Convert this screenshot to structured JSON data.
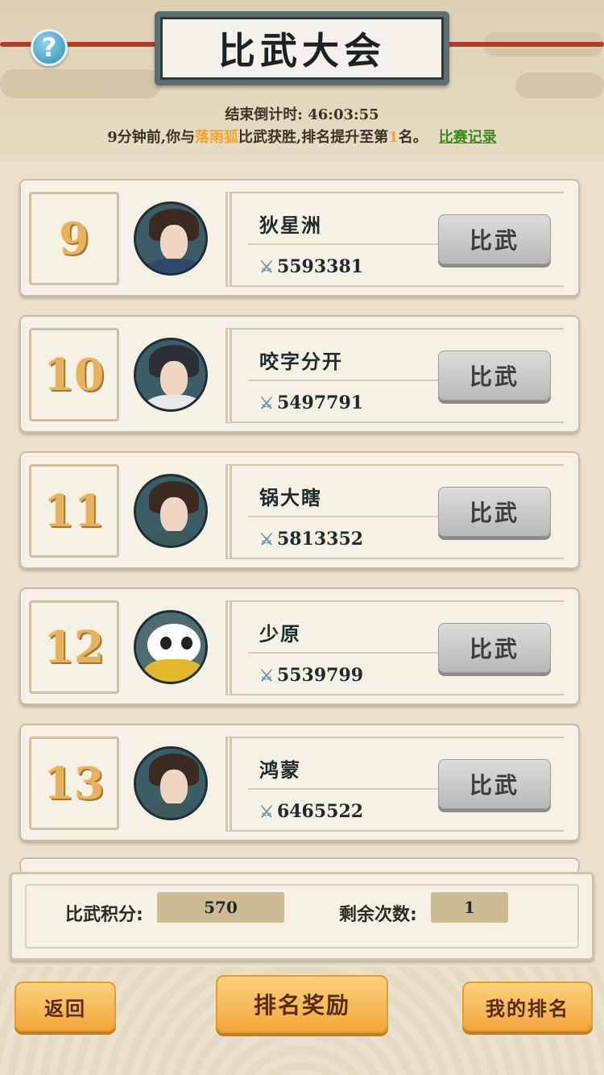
{
  "header": {
    "title": "比武大会",
    "help_icon": "question-icon",
    "help_label": "?"
  },
  "countdown": {
    "label": "结束倒计时:",
    "value": "46:03:55"
  },
  "notice": {
    "prefix": "9分钟前,你与",
    "opponent": "落雨狐",
    "middle": "比武获胜,排名提升至第",
    "rank": "1",
    "suffix": "名。",
    "record_link": "比赛记录"
  },
  "players": [
    {
      "rank": "9",
      "name": "狄星洲",
      "power": "5593381",
      "action": "比武"
    },
    {
      "rank": "10",
      "name": "咬字分开",
      "power": "5497791",
      "action": "比武"
    },
    {
      "rank": "11",
      "name": "锅大瞎",
      "power": "5813352",
      "action": "比武"
    },
    {
      "rank": "12",
      "name": "少原",
      "power": "5539799",
      "action": "比武"
    },
    {
      "rank": "13",
      "name": "鸿蒙",
      "power": "6465522",
      "action": "比武"
    }
  ],
  "stats": {
    "score_label": "比武积分:",
    "score_value": "570",
    "remaining_label": "剩余次数:",
    "remaining_value": "1"
  },
  "buttons": {
    "back": "返回",
    "rank_reward": "排名奖励",
    "my_rank": "我的排名"
  },
  "colors": {
    "accent_orange": "#f3a62b",
    "link_green": "#3f8a1a",
    "rank_gold": "#e6b25e"
  }
}
